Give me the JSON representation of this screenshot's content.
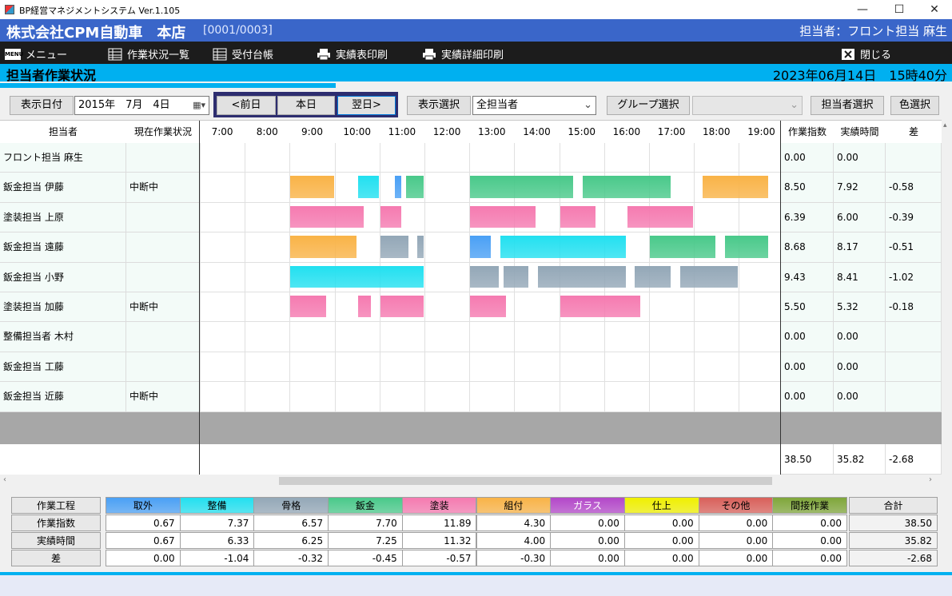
{
  "window": {
    "title": "BP経営マネジメントシステム Ver.1.105",
    "min": "—",
    "max": "☐",
    "close": "✕"
  },
  "header": {
    "company": "株式会社CPM自動車　本店",
    "code": "[0001/0003]",
    "person": "担当者：フロント担当 麻生"
  },
  "menu": {
    "menu": "メニュー",
    "status_list": "作業状況一覧",
    "reception": "受付台帳",
    "print_results": "実績表印刷",
    "print_details": "実績詳細印刷",
    "close": "閉じる"
  },
  "section": {
    "title": "担当者作業状況",
    "datetime": "2023年06月14日　15時40分"
  },
  "toolbar": {
    "display_date_label": "表示日付",
    "display_date_value": "2015年　7月　4日",
    "prev": "<前日",
    "today": "本日",
    "next": "翌日>",
    "display_select": "表示選択",
    "display_value": "全担当者",
    "group_select": "グループ選択",
    "group_value": "",
    "staff_select": "担当者選択",
    "color_select": "色選択"
  },
  "grid": {
    "col_staff": "担当者",
    "col_status": "現在作業状況",
    "hours": [
      "7:00",
      "8:00",
      "9:00",
      "10:00",
      "11:00",
      "12:00",
      "13:00",
      "14:00",
      "15:00",
      "16:00",
      "17:00",
      "18:00",
      "19:00"
    ],
    "col_index": "作業指数",
    "col_actual": "実績時間",
    "col_diff": "差",
    "rows": [
      {
        "name": "フロント担当 麻生",
        "status": "",
        "index": "0.00",
        "actual": "0.00",
        "diff": ""
      },
      {
        "name": "鈑金担当 伊藤",
        "status": "中断中",
        "index": "8.50",
        "actual": "7.92",
        "diff": "-0.58"
      },
      {
        "name": "塗装担当 上原",
        "status": "",
        "index": "6.39",
        "actual": "6.00",
        "diff": "-0.39"
      },
      {
        "name": "鈑金担当 遠藤",
        "status": "",
        "index": "8.68",
        "actual": "8.17",
        "diff": "-0.51"
      },
      {
        "name": "鈑金担当 小野",
        "status": "",
        "index": "9.43",
        "actual": "8.41",
        "diff": "-1.02"
      },
      {
        "name": "塗装担当 加藤",
        "status": "中断中",
        "index": "5.50",
        "actual": "5.32",
        "diff": "-0.18"
      },
      {
        "name": "整備担当者 木村",
        "status": "",
        "index": "0.00",
        "actual": "0.00",
        "diff": ""
      },
      {
        "name": "鈑金担当 工藤",
        "status": "",
        "index": "0.00",
        "actual": "0.00",
        "diff": ""
      },
      {
        "name": "鈑金担当 近藤",
        "status": "中断中",
        "index": "0.00",
        "actual": "0.00",
        "diff": ""
      }
    ],
    "totals": {
      "index": "38.50",
      "actual": "35.82",
      "diff": "-2.68"
    },
    "bars": [
      [],
      [
        {
          "s": 9.0,
          "e": 10.0,
          "c": "orange"
        },
        {
          "s": 10.5,
          "e": 11.0,
          "c": "cyan"
        },
        {
          "s": 11.33,
          "e": 11.5,
          "c": "blue"
        },
        {
          "s": 11.58,
          "e": 12.0,
          "c": "green"
        },
        {
          "s": 13.0,
          "e": 15.33,
          "c": "green"
        },
        {
          "s": 15.5,
          "e": 17.5,
          "c": "green"
        },
        {
          "s": 18.17,
          "e": 19.67,
          "c": "orange"
        }
      ],
      [
        {
          "s": 9.0,
          "e": 10.67,
          "c": "pink"
        },
        {
          "s": 11.0,
          "e": 11.5,
          "c": "pink"
        },
        {
          "s": 13.0,
          "e": 14.5,
          "c": "pink"
        },
        {
          "s": 15.0,
          "e": 15.83,
          "c": "pink"
        },
        {
          "s": 16.5,
          "e": 18.0,
          "c": "pink"
        }
      ],
      [
        {
          "s": 9.0,
          "e": 10.5,
          "c": "orange"
        },
        {
          "s": 11.0,
          "e": 11.67,
          "c": "gray"
        },
        {
          "s": 11.83,
          "e": 12.0,
          "c": "gray"
        },
        {
          "s": 13.0,
          "e": 13.5,
          "c": "blue"
        },
        {
          "s": 13.67,
          "e": 16.5,
          "c": "cyan"
        },
        {
          "s": 17.0,
          "e": 18.5,
          "c": "green"
        },
        {
          "s": 18.67,
          "e": 19.67,
          "c": "green"
        }
      ],
      [
        {
          "s": 9.0,
          "e": 12.0,
          "c": "cyan"
        },
        {
          "s": 13.0,
          "e": 13.67,
          "c": "gray"
        },
        {
          "s": 13.75,
          "e": 14.33,
          "c": "gray"
        },
        {
          "s": 14.5,
          "e": 16.5,
          "c": "gray"
        },
        {
          "s": 16.67,
          "e": 17.5,
          "c": "gray"
        },
        {
          "s": 17.67,
          "e": 19.0,
          "c": "gray"
        }
      ],
      [
        {
          "s": 9.0,
          "e": 9.83,
          "c": "pink"
        },
        {
          "s": 10.5,
          "e": 10.83,
          "c": "pink"
        },
        {
          "s": 11.0,
          "e": 12.0,
          "c": "pink"
        },
        {
          "s": 13.0,
          "e": 13.83,
          "c": "pink"
        },
        {
          "s": 15.0,
          "e": 16.83,
          "c": "pink"
        }
      ],
      [],
      [],
      []
    ]
  },
  "colors": {
    "blue": "#4aa0f5",
    "cyan": "#22e0f0",
    "gray": "#93a7b7",
    "green": "#49c98a",
    "pink": "#f57ab0",
    "orange": "#f9b347",
    "purple": "#b347c9",
    "yellow": "#f0f000",
    "red": "#d9605a",
    "olive": "#7fa63a"
  },
  "summary": {
    "label_process": "作業工程",
    "label_index": "作業指数",
    "label_actual": "実績時間",
    "label_diff": "差",
    "label_total": "合計",
    "processes": [
      {
        "name": "取外",
        "c": "blue",
        "index": "0.67",
        "actual": "0.67",
        "diff": "0.00"
      },
      {
        "name": "整備",
        "c": "cyan",
        "index": "7.37",
        "actual": "6.33",
        "diff": "-1.04"
      },
      {
        "name": "骨格",
        "c": "gray",
        "index": "6.57",
        "actual": "6.25",
        "diff": "-0.32"
      },
      {
        "name": "鈑金",
        "c": "green",
        "index": "7.70",
        "actual": "7.25",
        "diff": "-0.45"
      },
      {
        "name": "塗装",
        "c": "pink",
        "index": "11.89",
        "actual": "11.32",
        "diff": "-0.57"
      },
      {
        "name": "組付",
        "c": "orange",
        "index": "4.30",
        "actual": "4.00",
        "diff": "-0.30"
      },
      {
        "name": "ガラス",
        "c": "purple",
        "index": "0.00",
        "actual": "0.00",
        "diff": "0.00"
      },
      {
        "name": "仕上",
        "c": "yellow",
        "index": "0.00",
        "actual": "0.00",
        "diff": "0.00"
      },
      {
        "name": "その他",
        "c": "red",
        "index": "0.00",
        "actual": "0.00",
        "diff": "0.00"
      },
      {
        "name": "間接作業",
        "c": "olive",
        "index": "0.00",
        "actual": "0.00",
        "diff": "0.00"
      }
    ],
    "total": {
      "index": "38.50",
      "actual": "35.82",
      "diff": "-2.68"
    }
  }
}
